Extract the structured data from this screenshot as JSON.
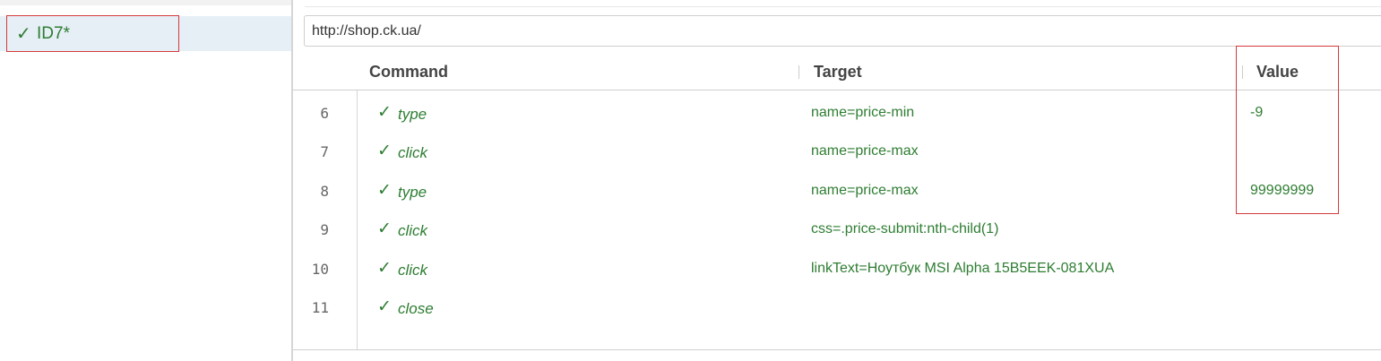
{
  "test_list": {
    "items": [
      {
        "check": "✓",
        "name": "ID7*"
      }
    ]
  },
  "base_url": {
    "value": "http://shop.ck.ua/"
  },
  "table": {
    "headers": {
      "command": "Command",
      "target": "Target",
      "value": "Value"
    },
    "rows": [
      {
        "num": "6",
        "check": "✓",
        "command": "type",
        "target": "name=price-min",
        "value": "-9"
      },
      {
        "num": "7",
        "check": "✓",
        "command": "click",
        "target": "name=price-max",
        "value": ""
      },
      {
        "num": "8",
        "check": "✓",
        "command": "type",
        "target": "name=price-max",
        "value": "99999999"
      },
      {
        "num": "9",
        "check": "✓",
        "command": "click",
        "target": "css=.price-submit:nth-child(1)",
        "value": ""
      },
      {
        "num": "10",
        "check": "✓",
        "command": "click",
        "target": "linkText=Ноутбук MSI Alpha 15B5EEK-081XUA",
        "value": ""
      },
      {
        "num": "11",
        "check": "✓",
        "command": "close",
        "target": "",
        "value": ""
      }
    ]
  },
  "colors": {
    "success": "#2e7d32",
    "highlight_border": "#d43a3a",
    "selected_bg": "#e6eef6"
  }
}
